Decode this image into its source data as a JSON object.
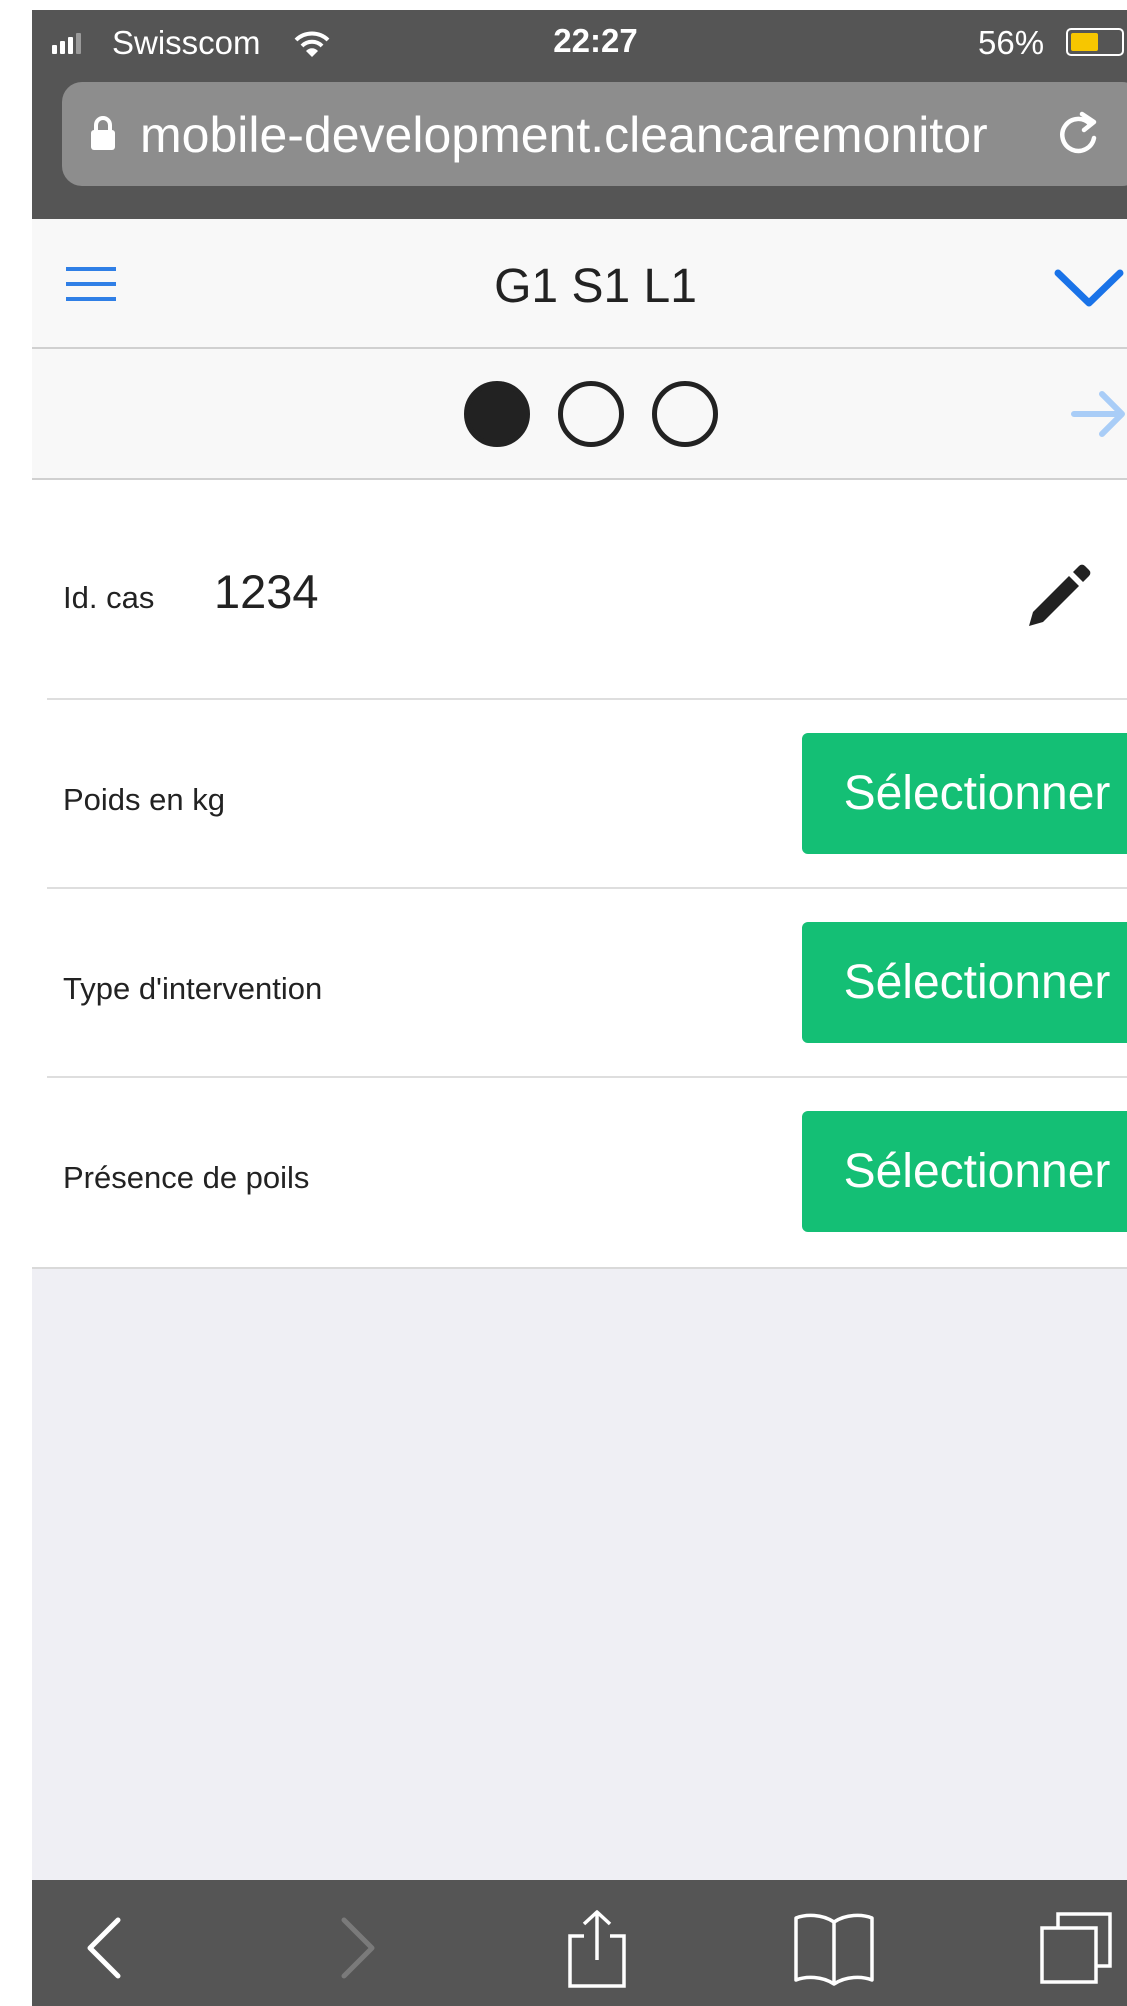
{
  "status_bar": {
    "carrier": "Swisscom",
    "time": "22:27",
    "battery": "56%",
    "battery_level": 0.56,
    "signal_icon": "signal-bars-icon",
    "wifi_icon": "wifi-icon"
  },
  "browser": {
    "url": "mobile-development.cleancaremonitor",
    "lock_icon": "lock-icon",
    "reload_icon": "reload-icon"
  },
  "nav": {
    "title": "G1 S1 L1",
    "menu_icon": "hamburger-menu-icon",
    "collapse_icon": "chevron-down-icon"
  },
  "steps": {
    "total": 3,
    "current": 1,
    "next_icon": "arrow-right-icon"
  },
  "form": {
    "case_id_label": "Id. cas",
    "case_id_value": "1234",
    "edit_icon": "pencil-icon",
    "fields": [
      {
        "label": "Poids en kg",
        "button": "Sélectionner"
      },
      {
        "label": "Type d'intervention",
        "button": "Sélectionner"
      },
      {
        "label": "Présence de poils",
        "button": "Sélectionner"
      }
    ]
  },
  "toolbar": {
    "back_icon": "back-icon",
    "forward_icon": "forward-icon",
    "share_icon": "share-icon",
    "bookmarks_icon": "bookmarks-icon",
    "tabs_icon": "tabs-icon"
  },
  "colors": {
    "accent": "#2f7fe6",
    "button": "#14bf75",
    "chrome": "#555555",
    "background": "#efeff4"
  }
}
